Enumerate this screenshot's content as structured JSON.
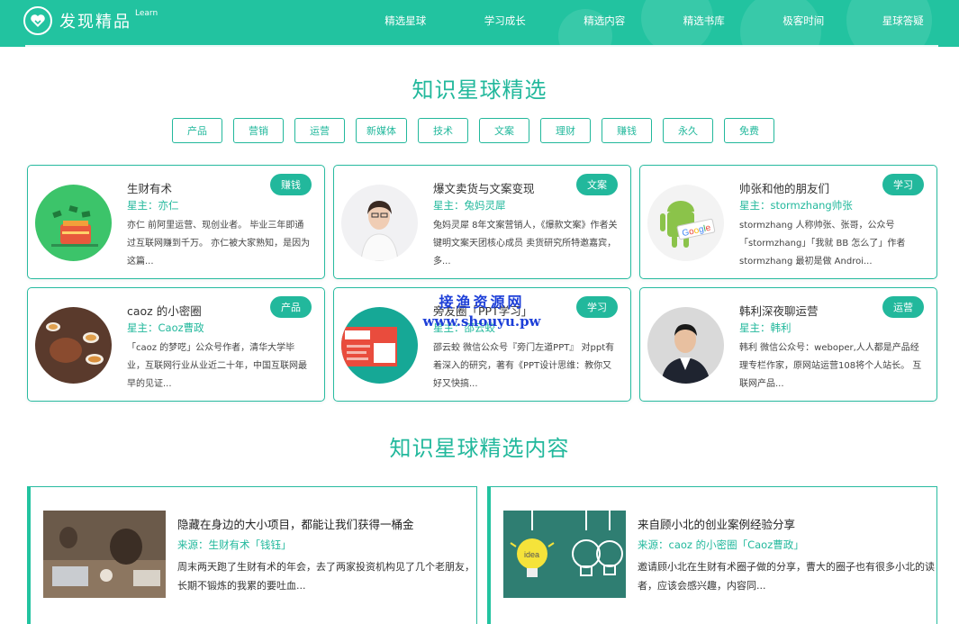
{
  "header": {
    "logo_text": "发现精品",
    "logo_sup": "Learn",
    "nav": [
      "精选星球",
      "学习成长",
      "精选内容",
      "精选书库",
      "极客时间",
      "星球答疑"
    ]
  },
  "section1": {
    "title": "知识星球精选",
    "tags": [
      "产品",
      "营销",
      "运营",
      "新媒体",
      "技术",
      "文案",
      "理财",
      "赚钱",
      "永久",
      "免费"
    ]
  },
  "planets": [
    {
      "title": "生财有术",
      "owner": "星主：亦仁",
      "badge": "赚钱",
      "desc": "亦仁 前阿里运营、现创业者。 毕业三年即通过互联网赚到千万。 亦仁被大家熟知，是因为这篇..."
    },
    {
      "title": "爆文卖货与文案变现",
      "owner": "星主：兔妈灵犀",
      "badge": "文案",
      "desc": "兔妈灵犀 8年文案营销人，《爆款文案》作者关键明文案天团核心成员 卖货研究所特邀嘉宾，多..."
    },
    {
      "title": "帅张和他的朋友们",
      "owner": "星主：stormzhang帅张",
      "badge": "学习",
      "desc": "stormzhang 人称帅张、张哥，公众号「stormzhang」「我就 BB 怎么了」作者 stormzhang 最初是做 Androi..."
    },
    {
      "title": "caoz 的小密圈",
      "owner": "星主：Caoz曹政",
      "badge": "产品",
      "desc": "「caoz 的梦呓」公众号作者，清华大学毕业，互联网行业从业近二十年，中国互联网最早的见证..."
    },
    {
      "title": "旁友圈「PPT学习」",
      "owner": "星主：邵云蛟",
      "badge": "学习",
      "desc": "邵云蛟 微信公众号『旁门左道PPT』 对ppt有着深入的研究，著有《PPT设计思维：教你又好又快搞..."
    },
    {
      "title": "韩利深夜聊运营",
      "owner": "星主：韩利",
      "badge": "运营",
      "desc": "韩利 微信公众号：weboper,人人都是产品经理专栏作家，原网站运营108将个人站长。 互联网产品..."
    }
  ],
  "section2": {
    "title": "知识星球精选内容"
  },
  "contents": [
    {
      "title": "隐藏在身边的大小项目，都能让我们获得一桶金",
      "source": "来源：生财有术「钱钰」",
      "desc": "周末两天跑了生财有术的年会，去了两家投资机构见了几个老朋友，长期不锻炼的我累的要吐血..."
    },
    {
      "title": "来自顾小北的创业案例经验分享",
      "source": "来源：caoz 的小密圈「Caoz曹政」",
      "desc": "邀请顾小北在生财有术圈子做的分享，曹大的圈子也有很多小北的读者，应该会感兴趣，内容同..."
    }
  ],
  "watermark": {
    "line1": "接渔资源网",
    "line2": "www.shouyu.pw"
  },
  "colors": {
    "brand": "#22c3a0",
    "accent": "#22b89c",
    "watermark": "#1d3fd8"
  }
}
